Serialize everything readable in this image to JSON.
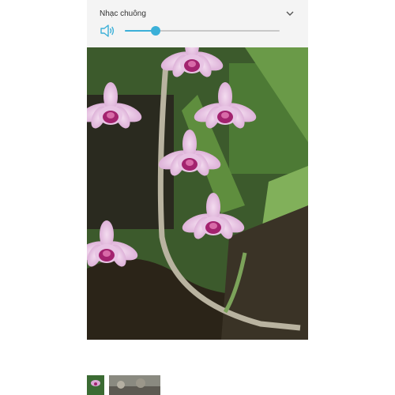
{
  "ringtone_panel": {
    "title": "Nhạc chuông",
    "volume_level": 0.2
  },
  "icons": {
    "speaker": "volume-icon",
    "chevron": "chevron-down-icon"
  },
  "colors": {
    "accent": "#3bb0d8",
    "panel_bg": "#f4f4f4"
  },
  "gallery": {
    "thumbnails": [
      "orchid-thumbnail",
      "garden-thumbnail"
    ]
  }
}
